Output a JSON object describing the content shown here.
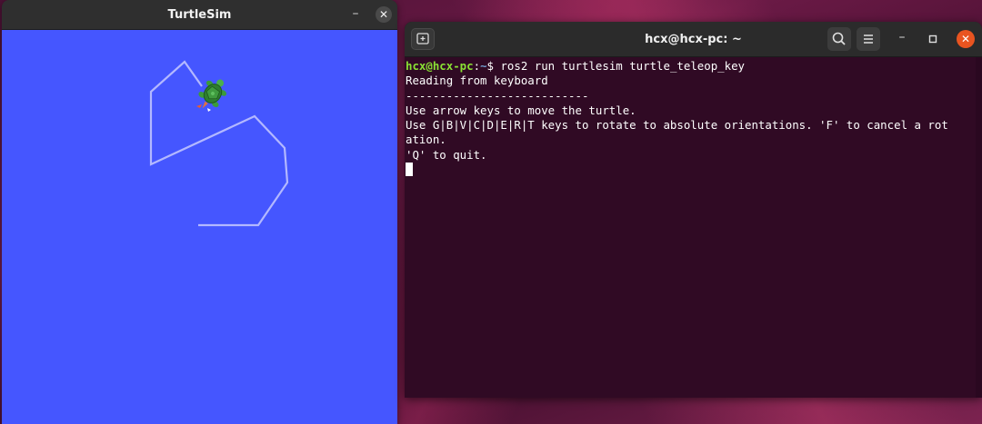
{
  "turtlesim": {
    "title": "TurtleSim",
    "minimize_glyph": "–",
    "close_glyph": "✕",
    "background_color": "#4556ff",
    "trail_color": "#b3b8ff",
    "icons": {
      "turtle": "turtle-sprite-icon"
    }
  },
  "terminal": {
    "title": "hcx@hcx-pc: ~",
    "minimize_glyph": "–",
    "close_glyph": "✕",
    "accent_close": "#e95420",
    "background_color": "#300a24",
    "prompt": {
      "user_host": "hcx@hcx-pc",
      "separator": ":",
      "path": "~",
      "symbol": "$ ",
      "command": "ros2 run turtlesim turtle_teleop_key"
    },
    "output": [
      "Reading from keyboard",
      "---------------------------",
      "Use arrow keys to move the turtle.",
      "Use G|B|V|C|D|E|R|T keys to rotate to absolute orientations. 'F' to cancel a rot",
      "ation.",
      "'Q' to quit."
    ],
    "icons": {
      "new_tab": "new-tab-icon",
      "search": "search-icon",
      "menu": "hamburger-menu-icon",
      "minimize": "minimize-icon",
      "maximize": "maximize-icon",
      "close": "close-icon"
    }
  }
}
